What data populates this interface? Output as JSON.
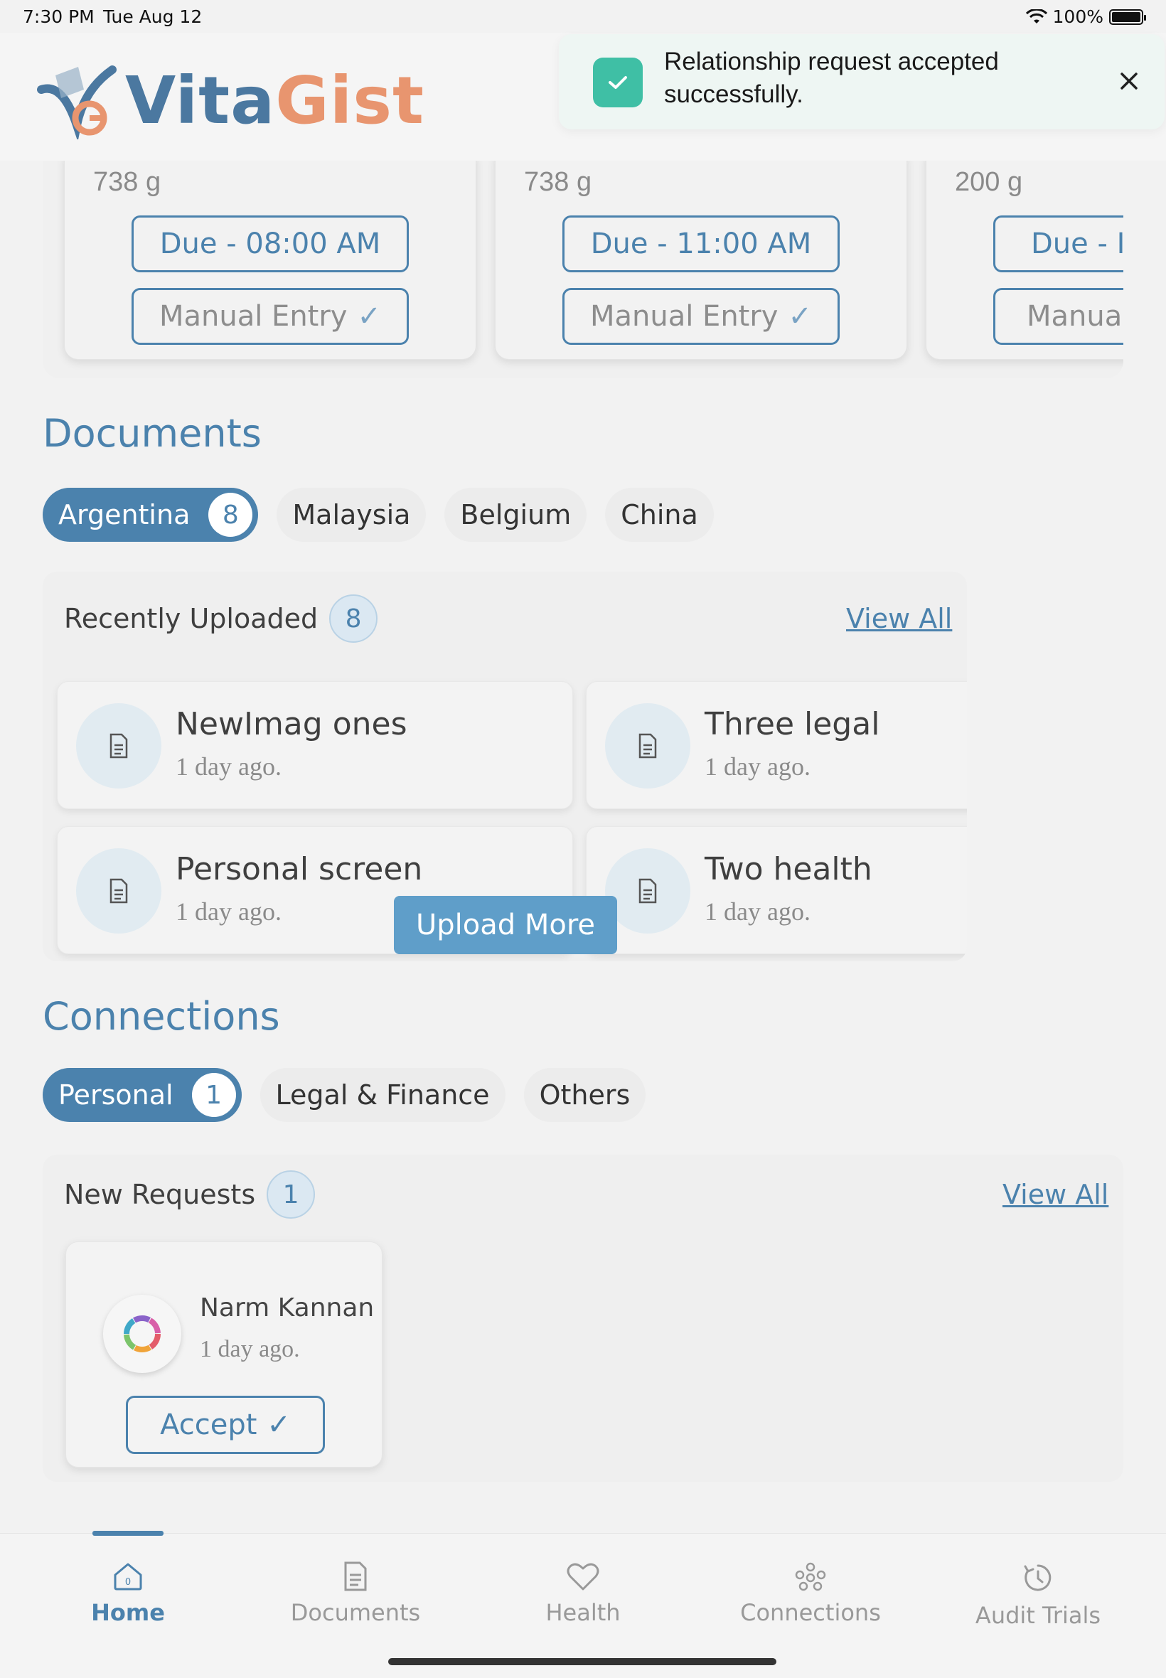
{
  "status": {
    "time": "7:30 PM",
    "date": "Tue Aug 12",
    "battery": "100%"
  },
  "brand": {
    "part1": "Vita",
    "part2": "Gist"
  },
  "toast": {
    "message": "Relationship request accepted successfully."
  },
  "schedule": [
    {
      "weight": "738 g",
      "due": "Due - 08:00 AM",
      "manual": "Manual Entry"
    },
    {
      "weight": "738 g",
      "due": "Due - 11:00 AM",
      "manual": "Manual Entry"
    },
    {
      "weight": "200 g",
      "due": "Due - I",
      "manual": "Manual"
    }
  ],
  "documents": {
    "title": "Documents",
    "tabs": [
      {
        "label": "Argentina",
        "count": "8"
      },
      {
        "label": "Malaysia"
      },
      {
        "label": "Belgium"
      },
      {
        "label": "China"
      }
    ],
    "recent": {
      "label": "Recently Uploaded",
      "count": "8",
      "view_all": "View All"
    },
    "items": [
      {
        "name": "NewImag ones",
        "time": "1 day ago."
      },
      {
        "name": "Three legal",
        "time": "1 day ago."
      },
      {
        "name": "Personal screen",
        "time": "1 day ago."
      },
      {
        "name": "Two health",
        "time": "1 day ago."
      }
    ],
    "upload_label": "Upload More"
  },
  "connections": {
    "title": "Connections",
    "tabs": [
      {
        "label": "Personal",
        "count": "1"
      },
      {
        "label": "Legal & Finance"
      },
      {
        "label": "Others"
      }
    ],
    "requests": {
      "label": "New Requests",
      "count": "1",
      "view_all": "View All"
    },
    "request": {
      "name": "Narm Kannan",
      "time": "1 day ago.",
      "accept": "Accept"
    }
  },
  "nav": [
    {
      "label": "Home",
      "icon": "home-icon",
      "active": true
    },
    {
      "label": "Documents",
      "icon": "document-icon"
    },
    {
      "label": "Health",
      "icon": "heart-icon"
    },
    {
      "label": "Connections",
      "icon": "connections-icon"
    },
    {
      "label": "Audit Trials",
      "icon": "history-icon"
    }
  ],
  "colors": {
    "primary": "#4b82ad",
    "accent": "#e8956f",
    "success": "#3fbfa5"
  }
}
